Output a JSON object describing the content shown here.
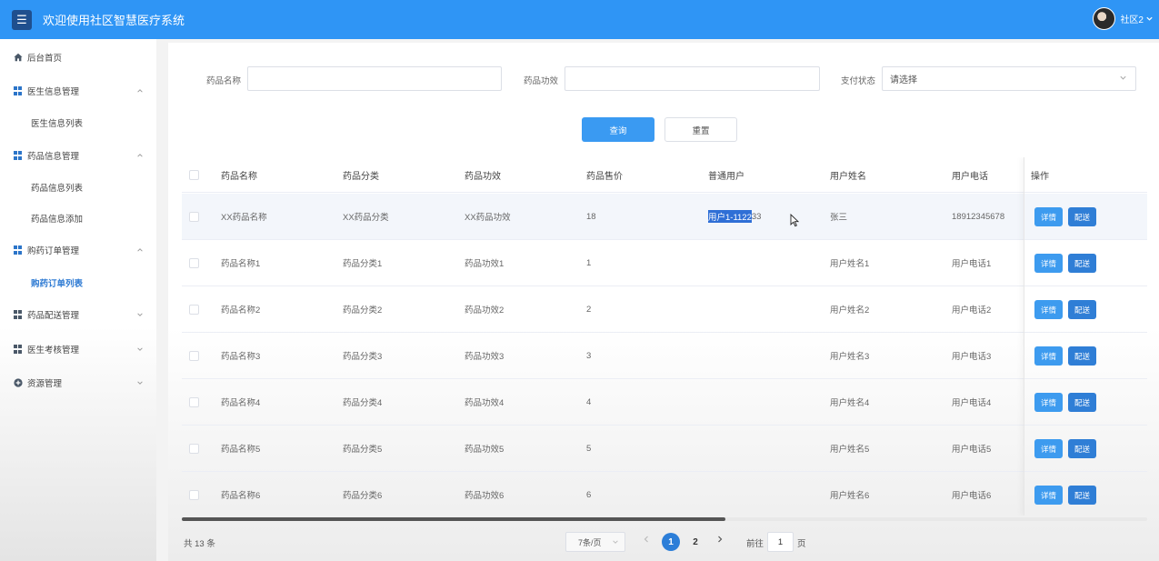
{
  "header": {
    "title": "欢迎使用社区智慧医疗系统",
    "user_name": "社区2",
    "menu_icon": "hamburger-icon",
    "background": "#2f95f5"
  },
  "sidebar": {
    "items": [
      {
        "label": "后台首页",
        "icon": "home-icon"
      },
      {
        "label": "医生信息管理",
        "icon": "grid-icon",
        "expanded": true
      },
      {
        "label": "医生信息列表",
        "sub": true
      },
      {
        "label": "药品信息管理",
        "icon": "grid-icon",
        "expanded": true
      },
      {
        "label": "药品信息列表",
        "sub": true
      },
      {
        "label": "药品信息添加",
        "sub": true
      },
      {
        "label": "购药订单管理",
        "icon": "grid-icon",
        "expanded": true
      },
      {
        "label": "购药订单列表",
        "sub": true,
        "active": true
      },
      {
        "label": "药品配送管理",
        "icon": "grid-icon",
        "expanded": false
      },
      {
        "label": "医生考核管理",
        "icon": "grid-icon",
        "expanded": false
      },
      {
        "label": "资源管理",
        "icon": "plus-circle-icon",
        "expanded": false
      }
    ]
  },
  "search": {
    "drug_name_label": "药品名称",
    "drug_name_value": "",
    "drug_effect_label": "药品功效",
    "drug_effect_value": "",
    "pay_status_label": "支付状态",
    "pay_status_value": "请选择",
    "query_button": "查询",
    "reset_button": "重置"
  },
  "table": {
    "headers": [
      "药品名称",
      "药品分类",
      "药品功效",
      "药品售价",
      "普通用户",
      "用户姓名",
      "用户电话",
      "操作"
    ],
    "detail_button": "详情",
    "deliver_button": "配送",
    "rows": [
      {
        "name": "XX药品名称",
        "category": "XX药品分类",
        "effect": "XX药品功效",
        "price": "18",
        "user_selected": "用户1-1122",
        "user_rest": "33",
        "real_name": "张三",
        "phone": "18912345678"
      },
      {
        "name": "药品名称1",
        "category": "药品分类1",
        "effect": "药品功效1",
        "price": "1",
        "user_selected": "",
        "user_rest": "",
        "real_name": "用户姓名1",
        "phone": "用户电话1"
      },
      {
        "name": "药品名称2",
        "category": "药品分类2",
        "effect": "药品功效2",
        "price": "2",
        "user_selected": "",
        "user_rest": "",
        "real_name": "用户姓名2",
        "phone": "用户电话2"
      },
      {
        "name": "药品名称3",
        "category": "药品分类3",
        "effect": "药品功效3",
        "price": "3",
        "user_selected": "",
        "user_rest": "",
        "real_name": "用户姓名3",
        "phone": "用户电话3"
      },
      {
        "name": "药品名称4",
        "category": "药品分类4",
        "effect": "药品功效4",
        "price": "4",
        "user_selected": "",
        "user_rest": "",
        "real_name": "用户姓名4",
        "phone": "用户电话4"
      },
      {
        "name": "药品名称5",
        "category": "药品分类5",
        "effect": "药品功效5",
        "price": "5",
        "user_selected": "",
        "user_rest": "",
        "real_name": "用户姓名5",
        "phone": "用户电话5"
      },
      {
        "name": "药品名称6",
        "category": "药品分类6",
        "effect": "药品功效6",
        "price": "6",
        "user_selected": "",
        "user_rest": "",
        "real_name": "用户姓名6",
        "phone": "用户电话6"
      }
    ]
  },
  "pagination": {
    "total": "共 13 条",
    "page_size": "7条/页",
    "pages": [
      "1",
      "2"
    ],
    "current_page": "1",
    "goto_prefix": "前往",
    "goto_value": "1",
    "goto_suffix": "页"
  },
  "colors": {
    "primary": "#2f95f5",
    "button": "#3a9af2",
    "active_page": "#2c7ed8",
    "selection": "#2f6fd6"
  }
}
